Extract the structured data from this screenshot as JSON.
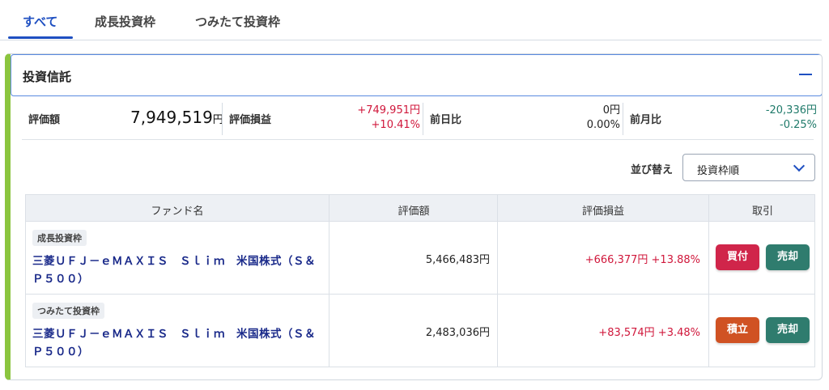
{
  "tabs": [
    "すべて",
    "成長投資枠",
    "つみたて投資枠"
  ],
  "panel": {
    "title": "投資信託",
    "collapse_icon": "minus-icon"
  },
  "summary": {
    "valuation_label": "評価額",
    "valuation_value": "7,949,519",
    "valuation_unit": "円",
    "pl_label": "評価損益",
    "pl_amount": "+749,951円",
    "pl_percent": "+10.41%",
    "day_label": "前日比",
    "day_amount": "0円",
    "day_percent": "0.00%",
    "month_label": "前月比",
    "month_amount": "-20,336円",
    "month_percent": "-0.25%"
  },
  "sort": {
    "label": "並び替え",
    "selected": "投資枠順"
  },
  "table": {
    "headers": [
      "ファンド名",
      "評価額",
      "評価損益",
      "取引"
    ],
    "rows": [
      {
        "badge": "成長投資枠",
        "fund": "三菱ＵＦＪ－ｅＭＡＸＩＳ　Ｓｌｉｍ　米国株式（Ｓ＆Ｐ５００）",
        "value": "5,466,483円",
        "pl": "+666,377円 +13.88%",
        "btn1": "買付",
        "btn2": "売却"
      },
      {
        "badge": "つみたて投資枠",
        "fund": "三菱ＵＦＪ－ｅＭＡＸＩＳ　Ｓｌｉｍ　米国株式（Ｓ＆Ｐ５００）",
        "value": "2,483,036円",
        "pl": "+83,574円 +3.48%",
        "btn1": "積立",
        "btn2": "売却"
      }
    ]
  },
  "colors": {
    "accent": "#1e4fc1",
    "positive": "#d0173b",
    "negative": "#1f7a6a",
    "panel_stripe": "#8bc53f"
  }
}
